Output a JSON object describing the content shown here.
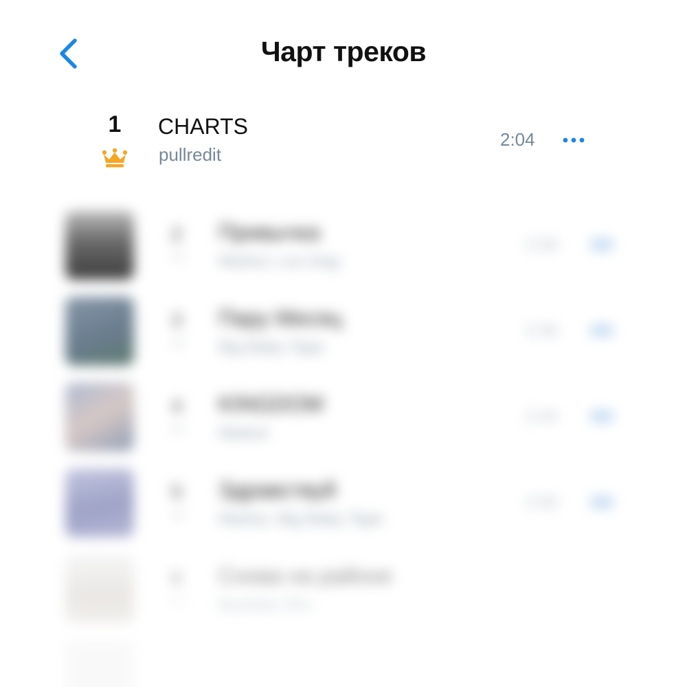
{
  "header": {
    "title": "Чарт треков",
    "back_icon": "chevron-left-icon",
    "accent_color": "#1a87e6"
  },
  "featured_track": {
    "rank": "1",
    "badge_icon": "crown-icon",
    "badge_color": "#f5a623",
    "title": "CHARTS",
    "artist": "pullredit",
    "duration": "2:04",
    "more_icon": "more-horizontal-icon"
  },
  "blurred_tracks": [
    {
      "rank": "2",
      "title": "Привычка",
      "artist": "Markul, Loc-Dog",
      "duration": "2:58"
    },
    {
      "rank": "3",
      "title": "Пару Месяц",
      "artist": "Big Baby Tape",
      "duration": "2:36"
    },
    {
      "rank": "4",
      "title": "KINGDOM",
      "artist": "Markul",
      "duration": "2:44"
    },
    {
      "rank": "5",
      "title": "Здравствуй",
      "artist": "Markul, Big Baby Tape",
      "duration": "2:50"
    },
    {
      "rank": "6",
      "title": "Снова на районе",
      "artist": "Bushido Zho",
      "duration": ""
    }
  ]
}
